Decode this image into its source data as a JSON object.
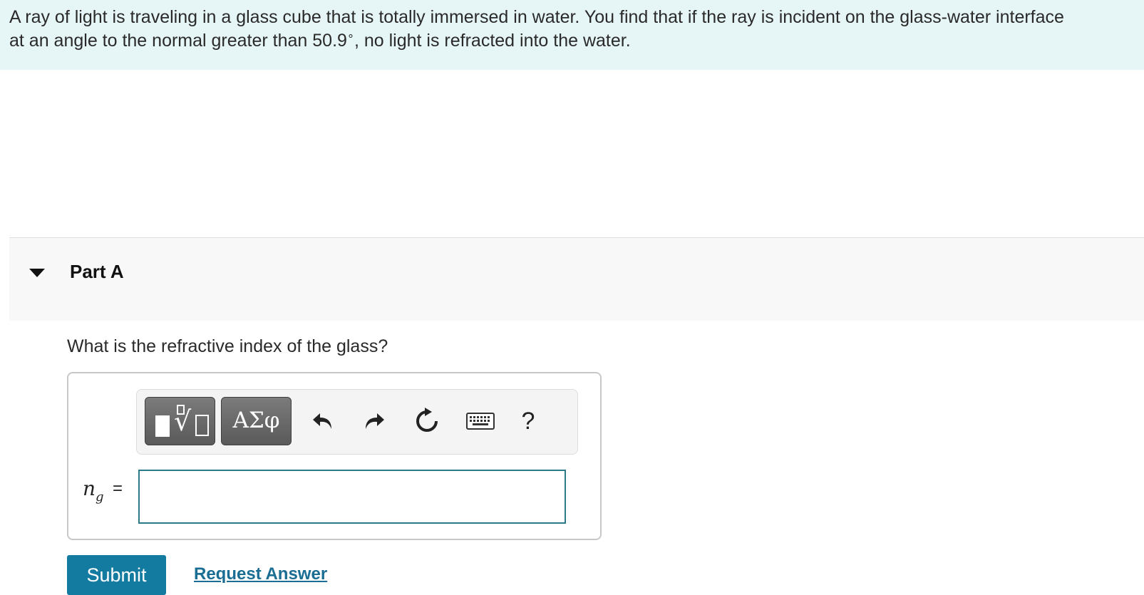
{
  "problem": {
    "text_line1": "A ray of light is traveling in a glass cube that is totally immersed in water. You find that if the ray is incident on the glass-water interface",
    "text_line2_before": "at an angle to the normal greater than 50.9",
    "degree_symbol": "∘",
    "text_line2_after": ", no light is refracted into the water."
  },
  "part": {
    "title": "Part A",
    "question": "What is the refractive index of the glass?"
  },
  "toolbar": {
    "templates_sqrt": "√",
    "symbols_label": "ΑΣφ",
    "icons": [
      "templates-icon",
      "symbols-icon",
      "undo-icon",
      "redo-icon",
      "reset-icon",
      "keyboard-icon",
      "help-icon"
    ],
    "help_label": "?"
  },
  "answer": {
    "variable": "n",
    "variable_subscript": "g",
    "equals": "=",
    "value": ""
  },
  "actions": {
    "submit_label": "Submit",
    "request_label": "Request Answer"
  },
  "colors": {
    "problem_bg": "#e6f5f6",
    "accent": "#137aa0",
    "link": "#1a6d93",
    "input_border": "#2a7b87"
  }
}
